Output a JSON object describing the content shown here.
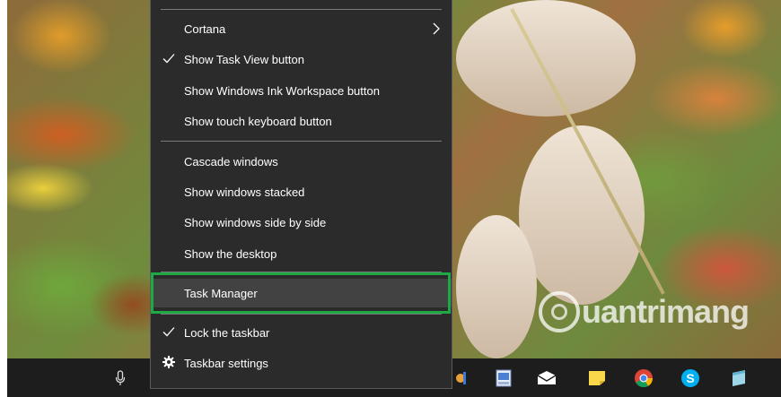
{
  "menu": {
    "items": [
      {
        "label": "Cortana",
        "checked": false,
        "submenu": true
      },
      {
        "label": "Show Task View button",
        "checked": true
      },
      {
        "label": "Show Windows Ink Workspace button",
        "checked": false
      },
      {
        "label": "Show touch keyboard button",
        "checked": false
      },
      {
        "label": "Cascade windows",
        "checked": false
      },
      {
        "label": "Show windows stacked",
        "checked": false
      },
      {
        "label": "Show windows side by side",
        "checked": false
      },
      {
        "label": "Show the desktop",
        "checked": false
      },
      {
        "label": "Task Manager",
        "checked": false,
        "highlighted": true
      },
      {
        "label": "Lock the taskbar",
        "checked": true
      },
      {
        "label": "Taskbar settings",
        "icon": "gear-icon"
      }
    ],
    "highlight_color": "#1fa846"
  },
  "watermark": {
    "text": "uantrimang"
  },
  "taskbar": {
    "icons": [
      "microphone-icon",
      "app-icon",
      "image-viewer-icon",
      "mail-icon",
      "sticky-notes-icon",
      "chrome-icon",
      "skype-icon",
      "notes-icon"
    ]
  }
}
